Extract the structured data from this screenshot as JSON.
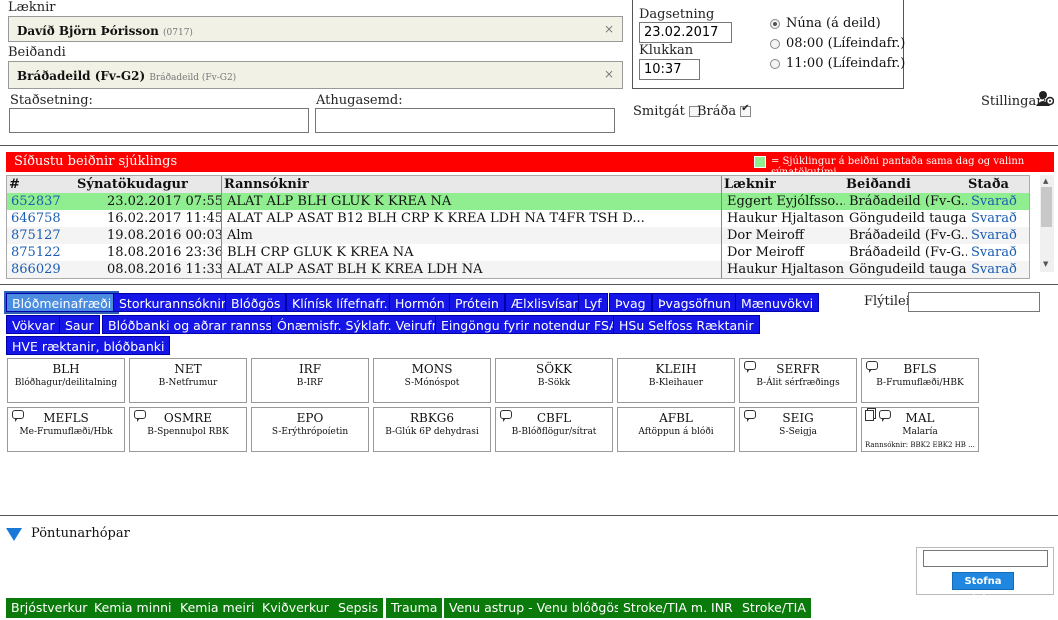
{
  "form": {
    "doctor_label": "Læknir",
    "doctor_name": "Davíð Björn Þórisson",
    "doctor_code": "(0717)",
    "requester_label": "Beiðandi",
    "requester_name": "Bráðadeild (Fv-G2)",
    "requester_sub": "Bráðadeild (Fv-G2)",
    "remove_symbol": "×",
    "location_label": "Staðsetning:",
    "location_value": "",
    "note_label": "Athugasemd:",
    "note_value": "",
    "date_label": "Dagsetning",
    "date_value": "23.02.2017",
    "time_label": "Klukkan",
    "time_value": "10:37",
    "radios": [
      "Núna (á deild)",
      "08:00 (Lífeindafr.)",
      "11:00 (Lífeindafr.)"
    ],
    "contagious_label": "Smitgát",
    "urgent_label": "Bráða",
    "settings_label": "Stillingar:"
  },
  "recent": {
    "title": "Síðustu beiðnir sjúklings",
    "legend": "= Sjúklingur á beiðni pantaða sama dag og valinn sýnatökutími",
    "headers": [
      "#",
      "Sýnatökudagur",
      "Rannsóknir",
      "Læknir",
      "Beiðandi",
      "Staða"
    ],
    "rows": [
      [
        "652837",
        "23.02.2017 07:55",
        "ALAT ALP BLH GLUK K KREA NA",
        "Eggert Eyjólfsso...",
        "Bráðadeild (Fv-G...",
        "Svarað"
      ],
      [
        "646758",
        "16.02.2017 11:45",
        "ALAT ALP ASAT B12 BLH CRP K KREA LDH NA T4FR TSH D...",
        "Haukur Hjaltason",
        "Göngudeild tauga...",
        "Svarað"
      ],
      [
        "875127",
        "19.08.2016 00:03",
        "Alm",
        "Dor Meiroff",
        "Bráðadeild (Fv-G...",
        "Svarað"
      ],
      [
        "875122",
        "18.08.2016 23:36",
        "BLH CRP GLUK K KREA NA",
        "Dor Meiroff",
        "Bráðadeild (Fv-G...",
        "Svarað"
      ],
      [
        "866029",
        "08.08.2016 11:33",
        "ALAT ALP ASAT BLH K KREA LDH NA",
        "Haukur Hjaltason",
        "Göngudeild tauga...",
        "Svarað"
      ]
    ]
  },
  "categories": [
    "Blóðmeinafræði",
    "Storkurannsóknir",
    "Blóðgös",
    "Klínísk lífefnafr.",
    "Hormón",
    "Prótein",
    "Ælxlisvísar",
    "Lyf",
    "Þvag",
    "Þvagsöfnun",
    "Mænuvökvi",
    "Vökvar",
    "Saur",
    "Blóðbanki og aðrar rannsst",
    "Ónæmisfr. Sýklafr. Veirufr.",
    "Eingöngu fyrir notendur FSA",
    "HSu Selfoss Ræktanir",
    "HVE ræktanir, blóðbanki"
  ],
  "filter_label": "Flýtileit",
  "filter_value": "",
  "tests": [
    {
      "code": "BLH",
      "desc": "Blóðhagur/deilitalning"
    },
    {
      "code": "NET",
      "desc": "B-Netfrumur"
    },
    {
      "code": "IRF",
      "desc": "B-IRF"
    },
    {
      "code": "MONS",
      "desc": "S-Mónóspot"
    },
    {
      "code": "SÖKK",
      "desc": "B-Sökk"
    },
    {
      "code": "KLEIH",
      "desc": "B-Kleihauer"
    },
    {
      "code": "SERFR",
      "desc": "B-Álit sérfræðings"
    },
    {
      "code": "BFLS",
      "desc": "B-Frumuflæði/HBK"
    },
    {
      "code": "MEFLS",
      "desc": "Me-Frumuflæði/Hbk"
    },
    {
      "code": "OSMRE",
      "desc": "B-Spennuþol RBK"
    },
    {
      "code": "EPO",
      "desc": "S-Erýthrópoíetin"
    },
    {
      "code": "RBKG6",
      "desc": "B-Glúk 6P dehydrasi"
    },
    {
      "code": "CBFL",
      "desc": "B-Blóðflögur/sítrat"
    },
    {
      "code": "AFBL",
      "desc": "Aftöppun á blóði"
    },
    {
      "code": "SEIG",
      "desc": "S-Seigja"
    },
    {
      "code": "MAL",
      "desc": "Malaría",
      "extra": "Rannsóknir: BBK2 EBK2 HB ..."
    }
  ],
  "groups_title": "Pöntunarhópar",
  "group_search_value": "",
  "create_group_label": "Stofna hóp",
  "groups": [
    "Brjóstverkur",
    "Kemia minni",
    "Kemia meiri",
    "Kviðverkur",
    "Sepsis",
    "Trauma",
    "Venu astrup - Venu blóðgös",
    "Stroke/TIA m. INR",
    "Stroke/TIA"
  ],
  "colors": {
    "active_row": "#90ee90",
    "category": "#1515e8",
    "group": "#0a7a0a",
    "header_bar": "#ff0000",
    "link": "#1a5db3"
  }
}
